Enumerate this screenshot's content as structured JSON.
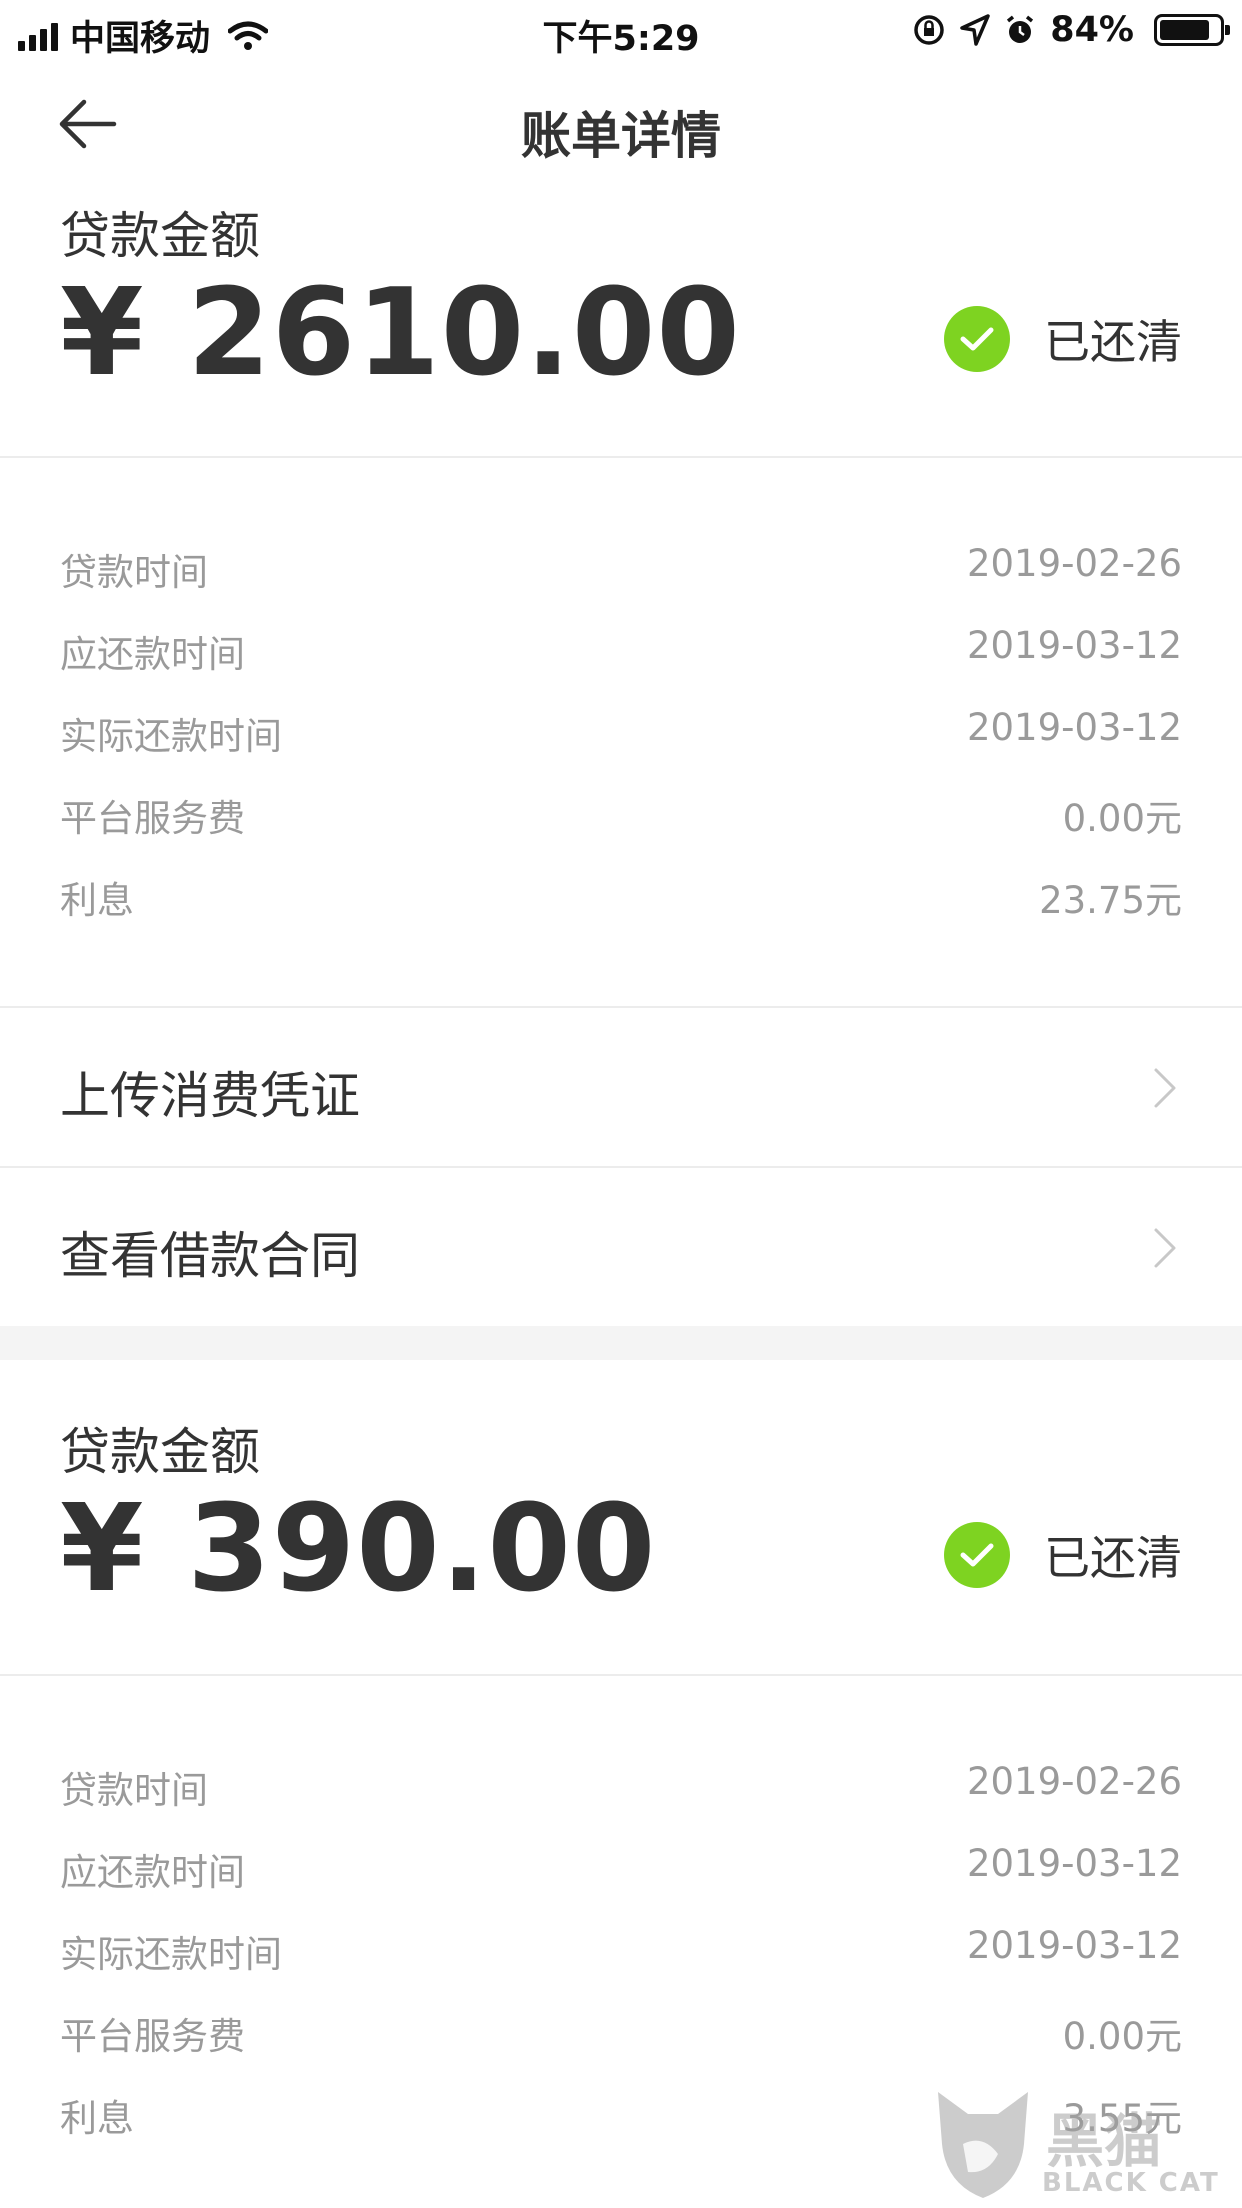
{
  "status_bar": {
    "carrier": "中国移动",
    "time": "下午5:29",
    "battery_percent": "84%",
    "battery_level": 0.84
  },
  "nav": {
    "title": "账单详情"
  },
  "bills": [
    {
      "amount_label": "贷款金额",
      "amount": "¥ 2610.00",
      "status": "已还清",
      "details": [
        {
          "label": "贷款时间",
          "value": "2019-02-26"
        },
        {
          "label": "应还款时间",
          "value": "2019-03-12"
        },
        {
          "label": "实际还款时间",
          "value": "2019-03-12"
        },
        {
          "label": "平台服务费",
          "value": "0.00元"
        },
        {
          "label": "利息",
          "value": "23.75元"
        }
      ]
    },
    {
      "amount_label": "贷款金额",
      "amount": "¥ 390.00",
      "status": "已还清",
      "details": [
        {
          "label": "贷款时间",
          "value": "2019-02-26"
        },
        {
          "label": "应还款时间",
          "value": "2019-03-12"
        },
        {
          "label": "实际还款时间",
          "value": "2019-03-12"
        },
        {
          "label": "平台服务费",
          "value": "0.00元"
        },
        {
          "label": "利息",
          "value": "3.55元"
        }
      ]
    }
  ],
  "links": {
    "upload_voucher": "上传消费凭证",
    "view_contract": "查看借款合同"
  },
  "watermark": {
    "text": "黑猫",
    "sub": "BLACK CAT"
  },
  "colors": {
    "accent_green": "#7ed321",
    "text_primary": "#333333",
    "text_secondary": "#9a9a9a"
  }
}
